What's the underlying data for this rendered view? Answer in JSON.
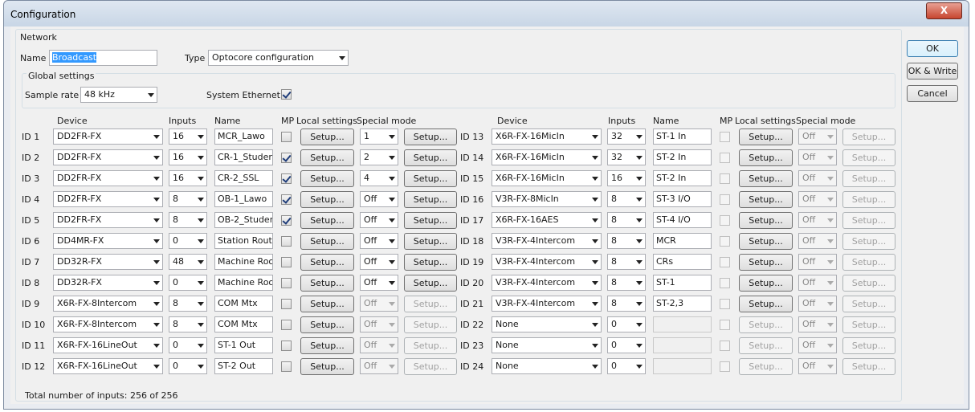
{
  "window": {
    "title": "Configuration",
    "close_label": "X"
  },
  "buttons": {
    "ok": "OK",
    "ok_write": "OK & Write",
    "cancel": "Cancel"
  },
  "network": {
    "group_label": "Network",
    "name_label": "Name",
    "name_value": "Broadcast",
    "type_label": "Type",
    "type_value": "Optocore configuration",
    "global_label": "Global settings",
    "sample_rate_label": "Sample rate",
    "sample_rate_value": "48 kHz",
    "system_ethernet_label": "System Ethernet",
    "system_ethernet_checked": true
  },
  "headers": {
    "device": "Device",
    "inputs": "Inputs",
    "name": "Name",
    "mp": "MP",
    "local_settings": "Local settings",
    "special_mode": "Special mode"
  },
  "rows": [
    {
      "id": "ID 1",
      "device": "DD2FR-FX",
      "inputs": "16",
      "name": "MCR_Lawo",
      "mp": false,
      "setup": "Setup...",
      "special": "1",
      "special_enabled": true,
      "special_setup": "Setup..."
    },
    {
      "id": "ID 2",
      "device": "DD2FR-FX",
      "inputs": "16",
      "name": "CR-1_Studer",
      "mp": true,
      "setup": "Setup...",
      "special": "2",
      "special_enabled": true,
      "special_setup": "Setup..."
    },
    {
      "id": "ID 3",
      "device": "DD2FR-FX",
      "inputs": "16",
      "name": "CR-2_SSL",
      "mp": true,
      "setup": "Setup...",
      "special": "4",
      "special_enabled": true,
      "special_setup": "Setup..."
    },
    {
      "id": "ID 4",
      "device": "DD2FR-FX",
      "inputs": "8",
      "name": "OB-1_Lawo",
      "mp": true,
      "setup": "Setup...",
      "special": "Off",
      "special_enabled": true,
      "special_setup": "Setup..."
    },
    {
      "id": "ID 5",
      "device": "DD2FR-FX",
      "inputs": "8",
      "name": "OB-2_Studer",
      "mp": true,
      "setup": "Setup...",
      "special": "Off",
      "special_enabled": true,
      "special_setup": "Setup..."
    },
    {
      "id": "ID 6",
      "device": "DD4MR-FX",
      "inputs": "0",
      "name": "Station Route",
      "mp": false,
      "setup": "Setup...",
      "special": "Off",
      "special_enabled": true,
      "special_setup": "Setup..."
    },
    {
      "id": "ID 7",
      "device": "DD32R-FX",
      "inputs": "48",
      "name": "Machine Roor",
      "mp": false,
      "setup": "Setup...",
      "special": "Off",
      "special_enabled": true,
      "special_setup": "Setup..."
    },
    {
      "id": "ID 8",
      "device": "DD32R-FX",
      "inputs": "0",
      "name": "Machine Roor",
      "mp": false,
      "setup": "Setup...",
      "special": "Off",
      "special_enabled": true,
      "special_setup": "Setup..."
    },
    {
      "id": "ID 9",
      "device": "X6R-FX-8Intercom",
      "inputs": "8",
      "name": "COM Mtx",
      "mp": false,
      "setup": "Setup...",
      "special": "Off",
      "special_enabled": false,
      "special_setup": "Setup..."
    },
    {
      "id": "ID 10",
      "device": "X6R-FX-8Intercom",
      "inputs": "8",
      "name": "COM Mtx",
      "mp": false,
      "setup": "Setup...",
      "special": "Off",
      "special_enabled": false,
      "special_setup": "Setup..."
    },
    {
      "id": "ID 11",
      "device": "X6R-FX-16LineOut",
      "inputs": "0",
      "name": "ST-1 Out",
      "mp": false,
      "setup": "Setup...",
      "special": "Off",
      "special_enabled": false,
      "special_setup": "Setup..."
    },
    {
      "id": "ID 12",
      "device": "X6R-FX-16LineOut",
      "inputs": "0",
      "name": "ST-2 Out",
      "mp": false,
      "setup": "Setup...",
      "special": "Off",
      "special_enabled": false,
      "special_setup": "Setup..."
    },
    {
      "id": "ID 13",
      "device": "X6R-FX-16MicIn",
      "inputs": "32",
      "name": "ST-1 In",
      "mp": false,
      "setup": "Setup...",
      "special": "Off",
      "special_enabled": false,
      "special_setup": "Setup...",
      "mp_enabled": false
    },
    {
      "id": "ID 14",
      "device": "X6R-FX-16MicIn",
      "inputs": "32",
      "name": "ST-2 In",
      "mp": false,
      "setup": "Setup...",
      "special": "Off",
      "special_enabled": false,
      "special_setup": "Setup...",
      "mp_enabled": false
    },
    {
      "id": "ID 15",
      "device": "X6R-FX-16MicIn",
      "inputs": "16",
      "name": "ST-2 In",
      "mp": false,
      "setup": "Setup...",
      "special": "Off",
      "special_enabled": false,
      "special_setup": "Setup...",
      "mp_enabled": false
    },
    {
      "id": "ID 16",
      "device": "V3R-FX-8MicIn",
      "inputs": "8",
      "name": "ST-3 I/O",
      "mp": false,
      "setup": "Setup...",
      "special": "Off",
      "special_enabled": false,
      "special_setup": "Setup...",
      "mp_enabled": false
    },
    {
      "id": "ID 17",
      "device": "X6R-FX-16AES",
      "inputs": "8",
      "name": "ST-4 I/O",
      "mp": false,
      "setup": "Setup...",
      "special": "Off",
      "special_enabled": false,
      "special_setup": "Setup...",
      "mp_enabled": false
    },
    {
      "id": "ID 18",
      "device": "V3R-FX-4Intercom",
      "inputs": "8",
      "name": "MCR",
      "mp": false,
      "setup": "Setup...",
      "special": "Off",
      "special_enabled": false,
      "special_setup": "Setup...",
      "mp_enabled": false
    },
    {
      "id": "ID 19",
      "device": "V3R-FX-4Intercom",
      "inputs": "8",
      "name": "CRs",
      "mp": false,
      "setup": "Setup...",
      "special": "Off",
      "special_enabled": false,
      "special_setup": "Setup...",
      "mp_enabled": false
    },
    {
      "id": "ID 20",
      "device": "V3R-FX-4Intercom",
      "inputs": "8",
      "name": "ST-1",
      "mp": false,
      "setup": "Setup...",
      "special": "Off",
      "special_enabled": false,
      "special_setup": "Setup...",
      "mp_enabled": false
    },
    {
      "id": "ID 21",
      "device": "V3R-FX-4Intercom",
      "inputs": "8",
      "name": "ST-2,3",
      "mp": false,
      "setup": "Setup...",
      "special": "Off",
      "special_enabled": false,
      "special_setup": "Setup...",
      "mp_enabled": false
    },
    {
      "id": "ID 22",
      "device": "None",
      "inputs": "0",
      "name": "",
      "mp": false,
      "setup": "Setup...",
      "special": "Off",
      "special_enabled": false,
      "special_setup": "Setup...",
      "mp_enabled": false,
      "name_enabled": false,
      "setup_enabled": false
    },
    {
      "id": "ID 23",
      "device": "None",
      "inputs": "0",
      "name": "",
      "mp": false,
      "setup": "Setup...",
      "special": "Off",
      "special_enabled": false,
      "special_setup": "Setup...",
      "mp_enabled": false,
      "name_enabled": false,
      "setup_enabled": false
    },
    {
      "id": "ID 24",
      "device": "None",
      "inputs": "0",
      "name": "",
      "mp": false,
      "setup": "Setup...",
      "special": "Off",
      "special_enabled": false,
      "special_setup": "Setup...",
      "mp_enabled": false,
      "name_enabled": false,
      "setup_enabled": false
    }
  ],
  "footer": {
    "total_inputs": "Total number of inputs: 256 of 256"
  }
}
